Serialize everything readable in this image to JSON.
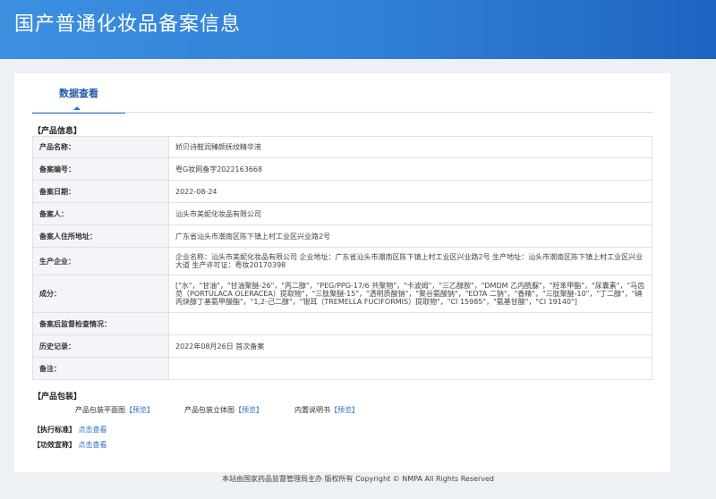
{
  "header": {
    "title": "国产普通化妆品备案信息"
  },
  "tabs": [
    {
      "label": "数据查看"
    }
  ],
  "product_info": {
    "section_title": "【产品信息】",
    "rows": [
      {
        "label": "产品名称：",
        "value": "娇贝诗鞋润臻颜抚纹精华液"
      },
      {
        "label": "备案编号：",
        "value": "粤G妆网备字2022163668"
      },
      {
        "label": "备案日期：",
        "value": "2022-08-24"
      },
      {
        "label": "备案人：",
        "value": "汕头市美妮化妆品有限公司"
      },
      {
        "label": "备案人住所地址：",
        "value": "广东省汕头市潮南区陈下镇上村工业区兴业路2号"
      },
      {
        "label": "生产企业：",
        "value": "企业名称：汕头市美妮化妆品有限公司 企业地址：广东省汕头市潮南区陈下镇上村工业区兴业路2号 生产地址：汕头市潮南区陈下镇上村工业区兴业大道 生产许可证：粤妆20170398"
      },
      {
        "label": "成分：",
        "value": "[\"水\"，\"甘油\"，\"甘油聚醚-26\"，\"丙二醇\"，\"PEG/PPG-17/6 共聚物\"，\"卡波姆\"，\"三乙醇胺\"，\"DMDM 乙内酰脲\"，\"羟苯甲酯\"，\"尿囊素\"，\"马齿苋（PORTULACA OLERACEA）提取物\"，\"三肽聚醚-15\"，\"透明质酸钠\"，\"聚谷氨酸钠\"，\"EDTA 二钠\"，\"香精\"，\"三肽聚醚-10\"，\"丁二醇\"，\"碘丙炔醇丁基氨甲酸酯\"，\"1,2-己二醇\"，\"银耳（TREMELLA FUCIFORMIS）提取物\"，\"CI 15985\"，\"氨基甘酸\"，\"CI 19140\"]"
      },
      {
        "label": "备案后监督检查情况：",
        "value": ""
      },
      {
        "label": "历史记录：",
        "value": "2022年08月26日 首次备案"
      },
      {
        "label": "备注：",
        "value": ""
      }
    ]
  },
  "packaging": {
    "section_title": "【产品包装】",
    "items": [
      {
        "label": "产品包装平面图",
        "link": "【预览】"
      },
      {
        "label": "产品包装立体图",
        "link": "【预览】"
      },
      {
        "label": "内置说明书",
        "link": "【预览】"
      }
    ]
  },
  "standard": {
    "label": "【执行标准】",
    "link": "点击查看"
  },
  "efficacy": {
    "label": "【功效宣称】",
    "link": "点击查看"
  },
  "footer": {
    "text": "本站由国家药品监督管理局主办 版权所有 Copyright © NMPA All Rights Reserved"
  }
}
